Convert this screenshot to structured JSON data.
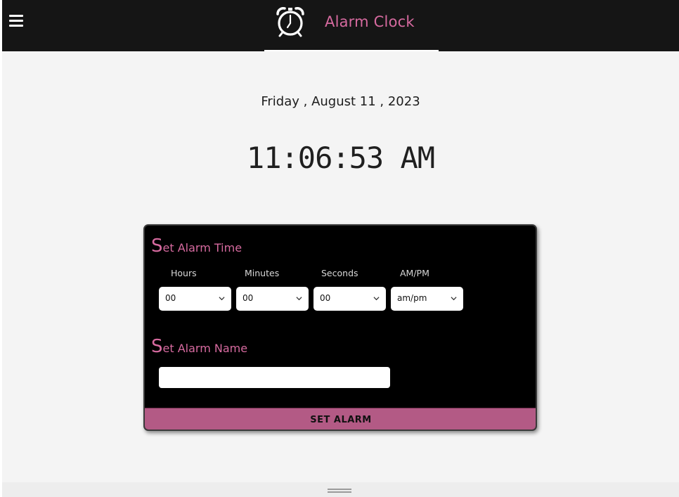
{
  "header": {
    "title": "Alarm Clock",
    "menu_icon": "hamburger-menu-icon",
    "logo_icon": "alarm-clock-icon",
    "accent_color": "#d66a9f",
    "background_color": "#151515"
  },
  "clock": {
    "date": "Friday , August 11 , 2023",
    "time": "11:06:53 AM"
  },
  "alarm_form": {
    "time_section": {
      "title_initial": "S",
      "title_rest": "et Alarm Time"
    },
    "columns": [
      {
        "label": "Hours",
        "selected": "00"
      },
      {
        "label": "Minutes",
        "selected": "00"
      },
      {
        "label": "Seconds",
        "selected": "00"
      },
      {
        "label": "AM/PM",
        "selected": "am/pm"
      }
    ],
    "name_section": {
      "title_initial": "S",
      "title_rest": "et Alarm Name"
    },
    "name_input": {
      "value": "",
      "placeholder": ""
    },
    "submit_label": "SET ALARM",
    "button_color": "#b35a85"
  }
}
